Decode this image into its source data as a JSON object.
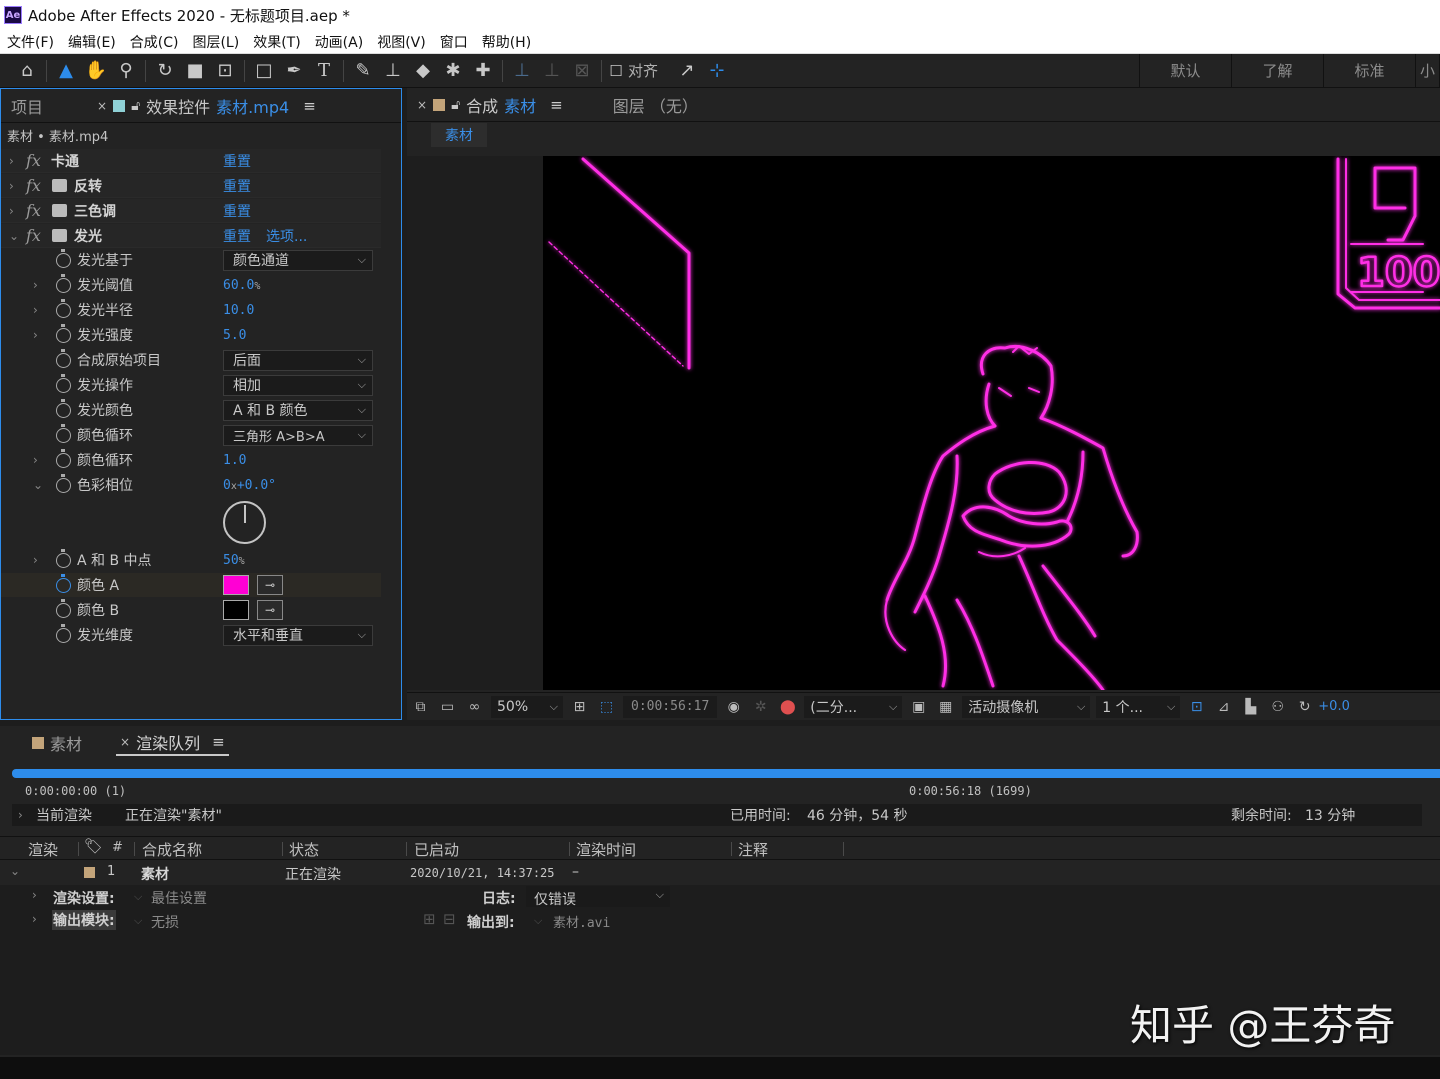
{
  "window": {
    "title": "Adobe After Effects 2020 - 无标题项目.aep *",
    "logo": "Ae"
  },
  "menu": [
    "文件(F)",
    "编辑(E)",
    "合成(C)",
    "图层(L)",
    "效果(T)",
    "动画(A)",
    "视图(V)",
    "窗口",
    "帮助(H)"
  ],
  "toolbar": {
    "align_label": "对齐",
    "workspaces": [
      "默认",
      "了解",
      "标准",
      "小"
    ]
  },
  "project_tab": "项目",
  "effects_panel": {
    "tab_prefix": "效果控件",
    "tab_file": "素材.mp4",
    "header": "素材 • 素材.mp4",
    "reset": "重置",
    "options": "选项...",
    "effects": [
      "卡通",
      "反转",
      "三色调",
      "发光"
    ],
    "params": {
      "glow_based_on": {
        "label": "发光基于",
        "value": "颜色通道"
      },
      "glow_threshold": {
        "label": "发光阈值",
        "value": "60.0",
        "unit": "%"
      },
      "glow_radius": {
        "label": "发光半径",
        "value": "10.0"
      },
      "glow_intensity": {
        "label": "发光强度",
        "value": "5.0"
      },
      "composite_original": {
        "label": "合成原始项目",
        "value": "后面"
      },
      "glow_operation": {
        "label": "发光操作",
        "value": "相加"
      },
      "glow_colors": {
        "label": "发光颜色",
        "value": "A 和 B 颜色"
      },
      "color_looping": {
        "label": "颜色循环",
        "value": "三角形 A>B>A"
      },
      "color_loops": {
        "label": "颜色循环",
        "value": "1.0"
      },
      "color_phase": {
        "label": "色彩相位",
        "rev": "0",
        "rev_unit": "x",
        "deg": "+0.0°"
      },
      "ab_midpoint": {
        "label": "A 和 B 中点",
        "value": "50",
        "unit": "%"
      },
      "color_a": {
        "label": "颜色 A",
        "color": "#ff00d4"
      },
      "color_b": {
        "label": "颜色 B",
        "color": "#000000"
      },
      "glow_dimensions": {
        "label": "发光维度",
        "value": "水平和垂直"
      }
    }
  },
  "comp_panel": {
    "tab_prefix": "合成",
    "tab_name": "素材",
    "layer_tab": "图层 （无）",
    "subtab": "素材",
    "canvas_number": "100",
    "canvas_digit": "9",
    "viewer": {
      "zoom": "50%",
      "timecode": "0:00:56:17",
      "resolution": "(二分...",
      "camera": "活动摄像机",
      "views": "1 个...",
      "exposure": "+0.0"
    }
  },
  "render_panel": {
    "tab_comp": "素材",
    "tab_queue": "渲染队列",
    "start_time": "0:00:00:00 (1)",
    "end_time": "0:00:56:18 (1699)",
    "current_render_label": "当前渲染",
    "current_render_value": "正在渲染\"素材\"",
    "elapsed_label": "已用时间:",
    "elapsed_value": "46 分钟，54 秒",
    "remaining_label": "剩余时间:",
    "remaining_value": "13 分钟",
    "progress": 1.0,
    "columns": [
      "渲染",
      "#",
      "合成名称",
      "状态",
      "已启动",
      "渲染时间",
      "注释"
    ],
    "item": {
      "index": "1",
      "name": "素材",
      "status": "正在渲染",
      "started": "2020/10/21, 14:37:25",
      "render_time": "–"
    },
    "render_settings_label": "渲染设置:",
    "render_settings_value": "最佳设置",
    "log_label": "日志:",
    "log_value": "仅错误",
    "output_module_label": "输出模块:",
    "output_module_value": "无损",
    "output_to_label": "输出到:",
    "output_to_value": "素材.avi"
  },
  "watermark": "知乎 @王芬奇"
}
